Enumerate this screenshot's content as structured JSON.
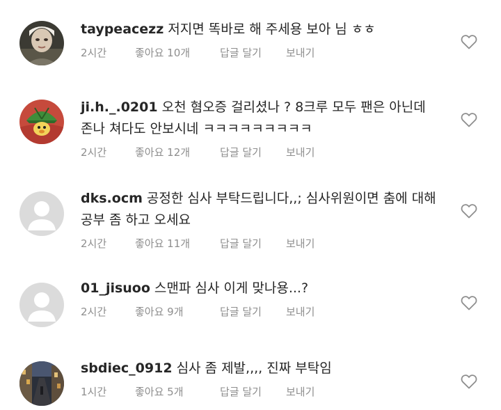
{
  "comments": [
    {
      "username": "taypeacezz",
      "text": "저지면 똑바로 해 주세용 보아 님 ㅎㅎ",
      "time": "2시간",
      "likes": "좋아요 10개",
      "reply": "답글 달기",
      "send": "보내기",
      "avatar": "photo-avatar",
      "liked": false
    },
    {
      "username": "ji.h._.0201",
      "text": "오천 혐오증 걸리셨나 ? 8크루 모두 팬은 아닌데 존나 쳐다도 안보시네 ㅋㅋㅋㅋㅋㅋㅋㅋㅋ",
      "time": "2시간",
      "likes": "좋아요 12개",
      "reply": "답글 달기",
      "send": "보내기",
      "avatar": "cartoon-avatar",
      "liked": false
    },
    {
      "username": "dks.ocm",
      "text": "공정한 심사 부탁드립니다,,; 심사위원이면 춤에 대해 공부 좀 하고 오세요",
      "time": "2시간",
      "likes": "좋아요 11개",
      "reply": "답글 달기",
      "send": "보내기",
      "avatar": "default-avatar",
      "liked": false
    },
    {
      "username": "01_jisuoo",
      "text": "스맨파 심사 이게 맞나용...?",
      "time": "2시간",
      "likes": "좋아요 9개",
      "reply": "답글 달기",
      "send": "보내기",
      "avatar": "default-avatar",
      "liked": false
    },
    {
      "username": "sbdiec_0912",
      "text": "심사 좀 제발,,,, 진짜 부탁임",
      "time": "1시간",
      "likes": "좋아요 5개",
      "reply": "답글 달기",
      "send": "보내기",
      "avatar": "street-photo-avatar",
      "liked": false
    }
  ],
  "icons": {
    "like": "heart-outline-icon"
  },
  "colors": {
    "text": "#262626",
    "meta": "#8e8e8e",
    "heart_stroke": "#8e8e8e",
    "default_avatar_bg": "#dbdbdb"
  }
}
